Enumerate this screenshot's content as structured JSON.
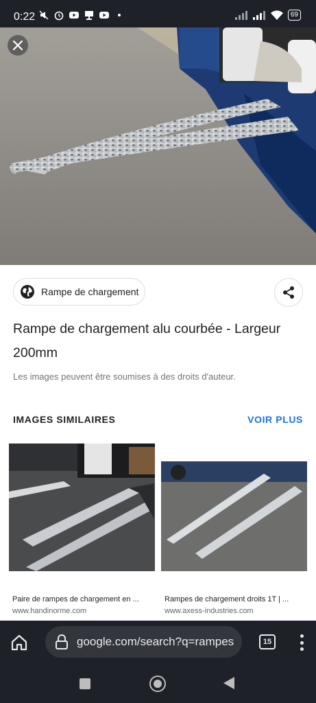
{
  "status_bar": {
    "time": "0:22",
    "battery": "69",
    "icons": [
      "mute-icon",
      "alarm-icon",
      "youtube-icon",
      "notification-icon",
      "youtube-icon",
      "signal-icon",
      "wifi-icon",
      "battery-icon"
    ]
  },
  "detail": {
    "source_label": "Rampe de chargement",
    "title": "Rampe de chargement alu courbée - Largeur 200mm",
    "copyright_note": "Les images peuvent être soumises à des droits d'auteur."
  },
  "similar": {
    "heading": "IMAGES SIMILAIRES",
    "more_link": "VOIR PLUS",
    "items": [
      {
        "title": "Paire de rampes de chargement en ...",
        "site": "www.handinorme.com"
      },
      {
        "title": "Rampes de chargement droits 1T | ...",
        "site": "www.axess-industries.com"
      }
    ]
  },
  "browser": {
    "url": "google.com/search?q=rampes",
    "tab_count": "15"
  },
  "colors": {
    "accent": "#1a73e8",
    "dark_bar": "#1f2129",
    "url_bar": "#34363d"
  }
}
